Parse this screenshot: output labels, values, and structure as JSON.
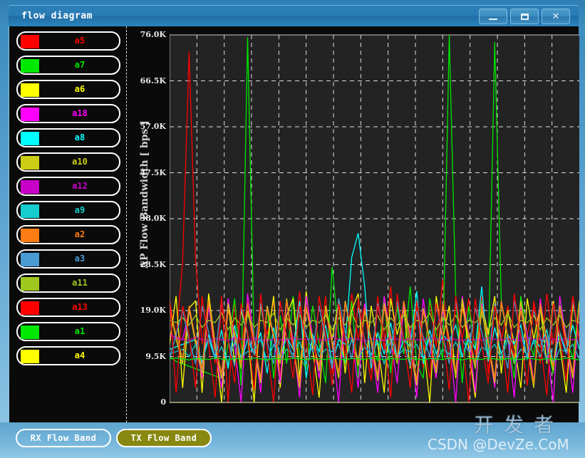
{
  "window": {
    "title": "flow diagram",
    "buttons": {
      "minimize": "–",
      "maximize": "□",
      "close": "✕"
    }
  },
  "legend": {
    "items": [
      {
        "label": "a5",
        "color": "#ff0000"
      },
      {
        "label": "a7",
        "color": "#00e800"
      },
      {
        "label": "a6",
        "color": "#ffff00"
      },
      {
        "label": "a18",
        "color": "#ff00ff"
      },
      {
        "label": "a8",
        "color": "#00ffff"
      },
      {
        "label": "a10",
        "color": "#cdcd16"
      },
      {
        "label": "a12",
        "color": "#c800c8"
      },
      {
        "label": "a9",
        "color": "#15cdcd"
      },
      {
        "label": "a2",
        "color": "#ff7b14"
      },
      {
        "label": "a3",
        "color": "#4a9bd4"
      },
      {
        "label": "a11",
        "color": "#9ec81e"
      },
      {
        "label": "a13",
        "color": "#ff0000"
      },
      {
        "label": "a1",
        "color": "#00e800"
      },
      {
        "label": "a4",
        "color": "#ffff00"
      }
    ]
  },
  "footer": {
    "rx_button": "RX Flow Band",
    "tx_button": "TX Flow Band",
    "rx_active": false,
    "tx_active": true
  },
  "watermark": {
    "chinese": "开发者",
    "english": "CSDN @DevZe.CoM"
  },
  "chart_data": {
    "type": "line",
    "title": "",
    "xlabel": "",
    "ylabel": "AP Flow Bandwidth [ bps ]",
    "ylim": [
      0,
      76000
    ],
    "yticks": [
      0,
      9500,
      19000,
      28500,
      38000,
      47500,
      57000,
      66500,
      76000
    ],
    "ytick_labels": [
      "0",
      "9.5K",
      "19.0K",
      "28.5K",
      "38.0K",
      "47.5K",
      "57.0K",
      "66.5K",
      "76.0K"
    ],
    "grid": true,
    "grid_style": "dashed",
    "grid_color": "#dcdcdc",
    "plot_bg": "#232323",
    "axis_color": "#c8c8c8",
    "x_gridlines": 14,
    "n_points": 64,
    "legend_position": "left-panel",
    "series": [
      {
        "name": "a5",
        "color": "#ff0000",
        "values": [
          21000,
          13000,
          29000,
          72500,
          29500,
          12000,
          21500,
          8000,
          22000,
          0,
          20500,
          11000,
          21000,
          9500,
          20000,
          14000,
          21000,
          5000,
          18000,
          11000,
          23000,
          7000,
          20000,
          12000,
          22000,
          6000,
          21000,
          9000,
          22500,
          13000,
          20500,
          6500,
          22000,
          11000,
          24000,
          9000,
          20000,
          14500,
          19500,
          7000,
          21000,
          11500,
          25500,
          8000,
          20000,
          13000,
          21500,
          10000,
          22000,
          6000,
          20500,
          12500,
          20000,
          9000,
          21500,
          14000,
          20000,
          8000,
          22500,
          12000,
          20000,
          10000,
          22000,
          13000
        ]
      },
      {
        "name": "a7",
        "color": "#00e800",
        "values": [
          9500,
          8500,
          8000,
          7500,
          7000,
          6500,
          6000,
          5500,
          5000,
          12000,
          21500,
          3500,
          75500,
          12000,
          4500,
          20000,
          5000,
          18000,
          8000,
          22000,
          9500,
          7000,
          20000,
          12000,
          4000,
          28000,
          14000,
          8000,
          21000,
          5000,
          19500,
          13000,
          8500,
          22000,
          6000,
          20000,
          10000,
          24000,
          8000,
          5000,
          21500,
          14000,
          9000,
          76000,
          22000,
          4000,
          20000,
          11000,
          21000,
          8500,
          74500,
          21000,
          13000,
          5000,
          22000,
          14000,
          9500,
          20000,
          12000,
          6000,
          21500,
          13500,
          9000,
          21000
        ]
      },
      {
        "name": "a6",
        "color": "#ffff00",
        "values": [
          12000,
          22000,
          3000,
          19500,
          21000,
          2000,
          22500,
          12000,
          0,
          21000,
          8000,
          19000,
          14000,
          0,
          20500,
          12000,
          22000,
          3000,
          18000,
          21500,
          5000,
          23000,
          11000,
          1000,
          20000,
          13000,
          21000,
          6000,
          19000,
          22500,
          4000,
          20000,
          12000,
          2000,
          21500,
          14000,
          19500,
          7000,
          21000,
          12500,
          0,
          22000,
          13000,
          20000,
          5000,
          21000,
          11000,
          1000,
          20500,
          14000,
          22000,
          6000,
          19000,
          12000,
          3000,
          21500,
          13000,
          20000,
          8000,
          21000,
          12000,
          2000,
          20500,
          13500
        ]
      },
      {
        "name": "a18",
        "color": "#ff00ff",
        "values": [
          14000,
          13500,
          13000,
          19000,
          12500,
          5000,
          20000,
          11000,
          3000,
          21500,
          12000,
          0,
          22500,
          13000,
          2000,
          20000,
          14000,
          4000,
          21000,
          12500,
          1000,
          22000,
          13500,
          5000,
          19500,
          12000,
          0,
          21000,
          14000,
          3000,
          20500,
          12500,
          2000,
          22000,
          13000,
          4000,
          20000,
          14500,
          1000,
          21500,
          12000,
          5000,
          19000,
          13000,
          0,
          22000,
          14000,
          2000,
          20500,
          12500,
          3000,
          21000,
          13500,
          1000,
          20000,
          14000,
          4000,
          21500,
          12000,
          0,
          22000,
          13000,
          2000,
          20500
        ]
      },
      {
        "name": "a8",
        "color": "#00ffff",
        "values": [
          11000,
          11500,
          12000,
          12500,
          13000,
          8000,
          14000,
          9000,
          15000,
          7000,
          16000,
          8500,
          13000,
          10000,
          14500,
          6000,
          15500,
          9500,
          13500,
          11000,
          21000,
          5000,
          14000,
          10500,
          16000,
          8000,
          13000,
          12000,
          30000,
          35000,
          24000,
          7000,
          14500,
          10000,
          16500,
          9000,
          13000,
          11500,
          23000,
          8000,
          15000,
          10000,
          14000,
          12500,
          16000,
          9500,
          13500,
          11000,
          24000,
          8500,
          15500,
          10000,
          14000,
          12000,
          16000,
          9000,
          13000,
          11500,
          15000,
          8000,
          14500,
          10500,
          16000,
          11000
        ]
      },
      {
        "name": "a10",
        "color": "#cdcd16",
        "values": [
          20000,
          13000,
          8000,
          19500,
          12000,
          6000,
          21000,
          11000,
          5000,
          20500,
          13500,
          7000,
          19000,
          12500,
          4000,
          20000,
          14000,
          8000,
          21500,
          11500,
          3000,
          19500,
          13000,
          6500,
          20000,
          12000,
          5000,
          21000,
          13500,
          7500,
          19000,
          12500,
          4500,
          20500,
          14000,
          8000,
          21000,
          11000,
          3500,
          19500,
          13000,
          6000,
          20000,
          12500,
          5500,
          21500,
          13000,
          7000,
          19000,
          12000,
          4000,
          20500,
          13500,
          8000,
          21000,
          11500,
          3000,
          19500,
          13000,
          6500,
          20000,
          12500,
          5000,
          21000
        ]
      },
      {
        "name": "a12",
        "color": "#c800c8",
        "values": [
          13500,
          13200,
          13000,
          12800,
          13500,
          13000,
          12500,
          13200,
          13000,
          12800,
          13400,
          13100,
          12900,
          13300,
          13000,
          12700,
          13200,
          13000,
          12800,
          13400,
          13100,
          12900,
          13200,
          13000,
          12800,
          13500,
          13100,
          12900,
          13300,
          13000,
          12700,
          13200,
          13000,
          12800,
          13400,
          13100,
          12900,
          13200,
          13000,
          12800,
          13500,
          13100,
          12900,
          13300,
          13000,
          12700,
          13200,
          13000,
          12800,
          13400,
          13100,
          12900,
          13200,
          13000,
          12800,
          13500,
          13100,
          12900,
          13300,
          13000,
          12700,
          13200,
          13000,
          12800
        ]
      },
      {
        "name": "a9",
        "color": "#15cdcd",
        "values": [
          10000,
          10500,
          11000,
          9500,
          12000,
          8500,
          13000,
          9000,
          11500,
          8000,
          12500,
          9500,
          10500,
          11000,
          13000,
          8500,
          12000,
          9000,
          11000,
          10000,
          12500,
          8000,
          13500,
          9500,
          11000,
          10500,
          12000,
          8500,
          13000,
          9000,
          11500,
          10000,
          12500,
          8000,
          13000,
          9500,
          11000,
          10500,
          12000,
          9000,
          13500,
          8500,
          11000,
          10000,
          12500,
          9500,
          13000,
          8000,
          11500,
          10500,
          12000,
          9000,
          13000,
          8500,
          11000,
          10000,
          12500,
          9500,
          13500,
          8000,
          11000,
          10500,
          12000,
          9000
        ]
      },
      {
        "name": "a2",
        "color": "#ff7b14",
        "values": [
          19500,
          14000,
          9000,
          20000,
          13000,
          7000,
          21000,
          12000,
          6000,
          19000,
          14500,
          8000,
          20500,
          12500,
          5000,
          19500,
          13500,
          9000,
          21000,
          11500,
          4000,
          20000,
          13000,
          7500,
          19000,
          12500,
          6000,
          20500,
          14000,
          8500,
          19500,
          13000,
          5500,
          20000,
          12000,
          9000,
          21000,
          13500,
          4500,
          19000,
          12500,
          7000,
          20500,
          13000,
          6500,
          19500,
          14000,
          8000,
          20000,
          12500,
          5000,
          21000,
          13500,
          9000,
          19000,
          12000,
          4000,
          20500,
          13000,
          7500,
          19500,
          12500,
          6000,
          20000
        ]
      },
      {
        "name": "a3",
        "color": "#4a9bd4",
        "values": [
          9000,
          14000,
          19000,
          13000,
          8000,
          20000,
          14500,
          9500,
          21000,
          13000,
          7500,
          19500,
          14000,
          10000,
          20500,
          12500,
          8000,
          21000,
          13500,
          9000,
          19000,
          14000,
          10500,
          20000,
          13000,
          7000,
          21500,
          14500,
          9000,
          19500,
          13000,
          8500,
          20500,
          14000,
          10000,
          21000,
          12500,
          7500,
          19000,
          13500,
          9500,
          20000,
          14000,
          8000,
          21000,
          13000,
          10500,
          19500,
          14500,
          9000,
          20500,
          13000,
          7000,
          21000,
          14000,
          9500,
          19000,
          13500,
          8500,
          20000,
          14000,
          10000,
          21000,
          13000
        ]
      },
      {
        "name": "a11",
        "color": "#9ec81e",
        "values": [
          17000,
          16500,
          17500,
          16000,
          18000,
          15500,
          17000,
          16500,
          18500,
          15000,
          17500,
          16000,
          18000,
          15500,
          17000,
          16500,
          18500,
          15000,
          17500,
          16000,
          18000,
          15500,
          17000,
          16500,
          18000,
          15000,
          17500,
          16000,
          18500,
          15500,
          17000,
          16500,
          18000,
          15000,
          17500,
          16000,
          18000,
          15500,
          17000,
          16500,
          18500,
          15000,
          17500,
          16000,
          18000,
          15500,
          17000,
          16500,
          18000,
          15000,
          17500,
          16000,
          18500,
          15500,
          17000,
          16500,
          18000,
          15000,
          17500,
          16000,
          18000,
          15500,
          17000,
          16500
        ]
      },
      {
        "name": "a13",
        "color": "#ff0000",
        "values": [
          21500,
          2000,
          20000,
          14000,
          3000,
          22000,
          12000,
          1000,
          21000,
          13000,
          4000,
          20500,
          14500,
          2500,
          22500,
          11500,
          0,
          21000,
          13500,
          5000,
          20000,
          12500,
          1500,
          22000,
          14000,
          3500,
          20500,
          13000,
          2000,
          21500,
          12000,
          4500,
          20000,
          14000,
          1000,
          22500,
          13000,
          3000,
          21000,
          12500,
          5000,
          20500,
          14500,
          2500,
          22000,
          13000,
          0,
          21500,
          12000,
          4000,
          20000,
          14000,
          2000,
          22500,
          13500,
          3500,
          21000,
          12500,
          1500,
          20500,
          14000,
          4500,
          22000,
          13000
        ]
      },
      {
        "name": "a1",
        "color": "#00e800",
        "values": [
          9000,
          9200,
          9000,
          8800,
          9100,
          9000,
          8900,
          9200,
          9000,
          8800,
          9100,
          9000,
          8900,
          9200,
          9000,
          8800,
          9100,
          9000,
          8900,
          9200,
          9000,
          8800,
          9100,
          9000,
          8900,
          9200,
          9000,
          8800,
          9100,
          9000,
          8900,
          9200,
          9000,
          8800,
          9100,
          9000,
          8900,
          9200,
          9000,
          8800,
          9100,
          9000,
          8900,
          9200,
          9000,
          8800,
          9100,
          9000,
          8900,
          9200,
          9000,
          8800,
          9100,
          9000,
          8900,
          9200,
          9000,
          8800,
          9100,
          9000,
          8900,
          9200,
          9000,
          8800
        ]
      },
      {
        "name": "a4",
        "color": "#ffff00",
        "values": [
          0,
          0,
          0,
          0,
          0,
          0,
          0,
          0,
          0,
          0,
          0,
          0,
          0,
          0,
          0,
          0,
          0,
          0,
          0,
          0,
          0,
          0,
          0,
          0,
          0,
          0,
          0,
          0,
          0,
          0,
          0,
          0,
          0,
          0,
          0,
          0,
          0,
          0,
          0,
          0,
          0,
          0,
          0,
          0,
          0,
          0,
          0,
          0,
          0,
          0,
          0,
          0,
          0,
          0,
          0,
          0,
          0,
          0,
          0,
          0,
          0,
          0,
          0,
          0
        ]
      }
    ]
  }
}
